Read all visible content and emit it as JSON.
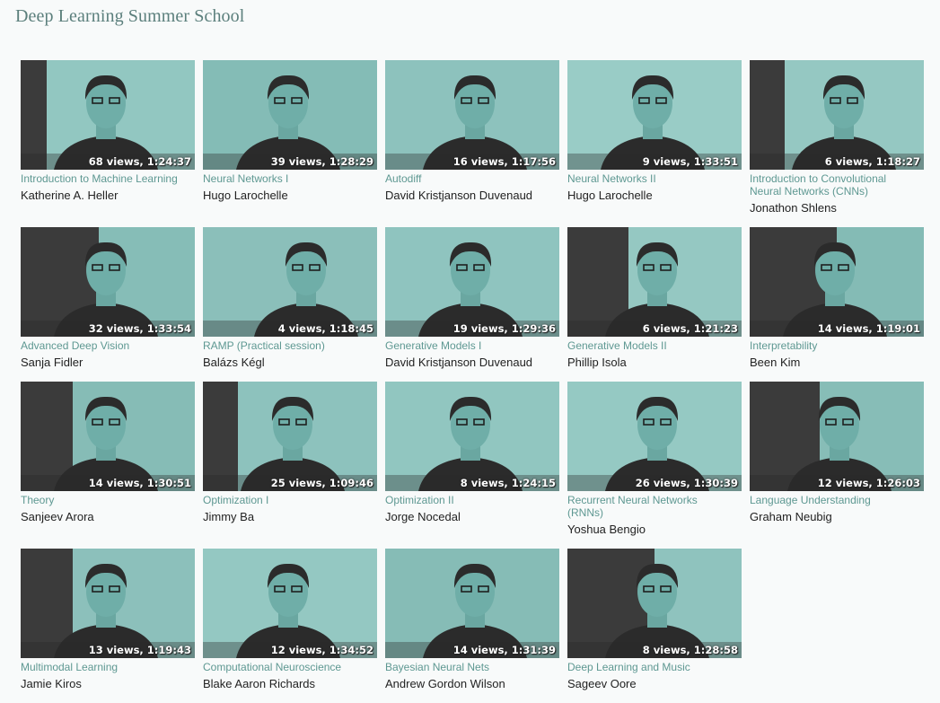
{
  "page": {
    "title": "Deep Learning Summer School"
  },
  "colors": {
    "thumb_bg": "#7fb8b2",
    "dark": "#2b2b2b",
    "title_link": "#5e9892",
    "header": "#5b7f7c"
  },
  "videos": [
    {
      "title": "Introduction to Machine Learning",
      "speaker": "Katherine A. Heller",
      "meta": "68 views, 1:24:37"
    },
    {
      "title": "Neural Networks I",
      "speaker": "Hugo Larochelle",
      "meta": "39 views, 1:28:29"
    },
    {
      "title": "Autodiff",
      "speaker": "David Kristjanson Duvenaud",
      "meta": "16 views, 1:17:56"
    },
    {
      "title": "Neural Networks II",
      "speaker": "Hugo Larochelle",
      "meta": "9 views, 1:33:51"
    },
    {
      "title": "Introduction to Convolutional Neural Networks (CNNs)",
      "speaker": "Jonathon Shlens",
      "meta": "6 views, 1:18:27"
    },
    {
      "title": "Advanced Deep Vision",
      "speaker": "Sanja Fidler",
      "meta": "32 views, 1:33:54"
    },
    {
      "title": "RAMP (Practical session)",
      "speaker": "Balázs Kégl",
      "meta": "4 views, 1:18:45"
    },
    {
      "title": "Generative Models I",
      "speaker": "David Kristjanson Duvenaud",
      "meta": "19 views, 1:29:36"
    },
    {
      "title": "Generative Models II",
      "speaker": "Phillip Isola",
      "meta": "6 views, 1:21:23"
    },
    {
      "title": "Interpretability",
      "speaker": "Been Kim",
      "meta": "14 views, 1:19:01"
    },
    {
      "title": "Theory",
      "speaker": "Sanjeev Arora",
      "meta": "14 views, 1:30:51"
    },
    {
      "title": "Optimization I",
      "speaker": "Jimmy Ba",
      "meta": "25 views, 1:09:46"
    },
    {
      "title": "Optimization II",
      "speaker": "Jorge Nocedal",
      "meta": "8 views, 1:24:15"
    },
    {
      "title": "Recurrent Neural Networks (RNNs)",
      "speaker": "Yoshua Bengio",
      "meta": "26 views, 1:30:39"
    },
    {
      "title": "Language Understanding",
      "speaker": "Graham Neubig",
      "meta": "12 views, 1:26:03"
    },
    {
      "title": "Multimodal Learning",
      "speaker": "Jamie Kiros",
      "meta": "13 views, 1:19:43"
    },
    {
      "title": "Computational Neuroscience",
      "speaker": "Blake Aaron Richards",
      "meta": "12 views, 1:34:52"
    },
    {
      "title": "Bayesian Neural Nets",
      "speaker": "Andrew Gordon Wilson",
      "meta": "14 views, 1:31:39"
    },
    {
      "title": "Deep Learning and Music",
      "speaker": "Sageev Oore",
      "meta": "8 views, 1:28:58"
    }
  ]
}
